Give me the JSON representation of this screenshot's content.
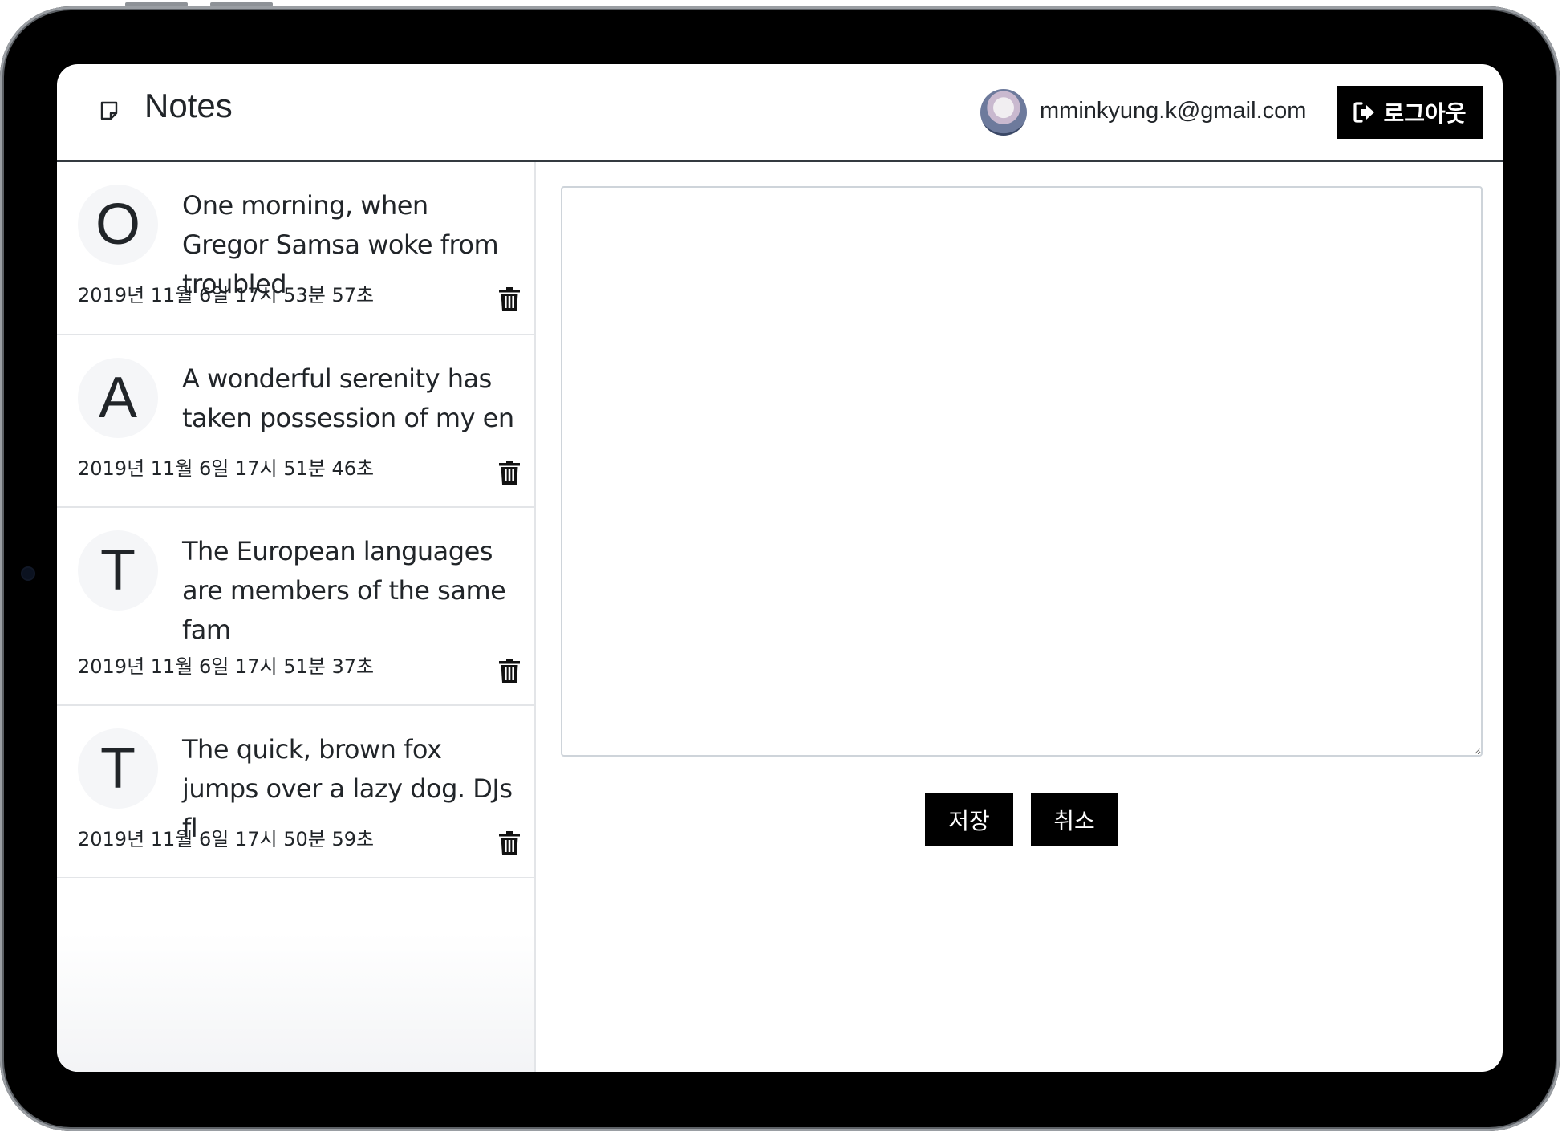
{
  "header": {
    "title": "Notes",
    "user_email": "mminkyung.k@gmail.com",
    "logout_label": "로그아웃"
  },
  "notes": [
    {
      "letter": "O",
      "preview": "One morning, when Gregor Samsa woke from troubled",
      "date": "2019년 11월 6일 17시 53분 57초"
    },
    {
      "letter": "A",
      "preview": "A wonderful serenity has taken possession of my en",
      "date": "2019년 11월 6일 17시 51분 46초"
    },
    {
      "letter": "T",
      "preview": "The European languages are members of the same fam",
      "date": "2019년 11월 6일 17시 51분 37초"
    },
    {
      "letter": "T",
      "preview": "The quick, brown fox jumps over a lazy dog. DJs fl",
      "date": "2019년 11월 6일 17시 50분 59초"
    }
  ],
  "editor": {
    "value": "",
    "save_label": "저장",
    "cancel_label": "취소"
  },
  "icons": {
    "brand": "sticky-note-icon",
    "logout": "sign-out-icon",
    "delete": "trash-icon"
  },
  "colors": {
    "button_bg": "#000000",
    "text": "#212529",
    "divider": "#343a40"
  }
}
